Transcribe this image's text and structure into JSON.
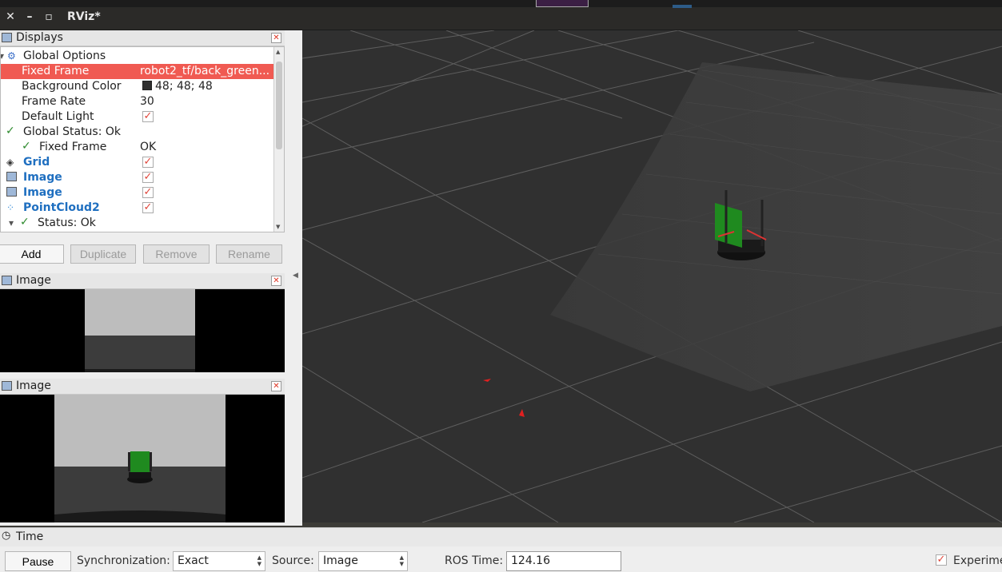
{
  "window": {
    "title": "RViz*"
  },
  "displays_panel": {
    "title": "Displays",
    "rows": {
      "global_options": "Global Options",
      "fixed_frame_label": "Fixed Frame",
      "fixed_frame_value": "robot2_tf/back_green...",
      "bg_color_label": "Background Color",
      "bg_color_value": "48; 48; 48",
      "frame_rate_label": "Frame Rate",
      "frame_rate_value": "30",
      "default_light_label": "Default Light",
      "global_status": "Global Status: Ok",
      "fixed_frame_status_label": "Fixed Frame",
      "fixed_frame_status_value": "OK",
      "grid": "Grid",
      "image1": "Image",
      "image2": "Image",
      "pointcloud": "PointCloud2",
      "status": "Status: Ok"
    },
    "buttons": {
      "add": "Add",
      "duplicate": "Duplicate",
      "remove": "Remove",
      "rename": "Rename"
    }
  },
  "image_panel_1": {
    "title": "Image"
  },
  "image_panel_2": {
    "title": "Image"
  },
  "time_panel": {
    "title": "Time",
    "pause": "Pause",
    "sync_label": "Synchronization:",
    "sync_value": "Exact",
    "source_label": "Source:",
    "source_value": "Image",
    "ros_time_label": "ROS Time:",
    "ros_time_value": "124.16",
    "experimental_label": "Experime"
  },
  "colors": {
    "background": "#303030",
    "selection": "#f05a52",
    "robot_green": "#1f8a1f"
  },
  "icons": [
    "close-icon",
    "minimize-icon",
    "maximize-icon",
    "monitor-icon",
    "gear-icon",
    "grid-icon",
    "image-icon",
    "pointcloud-icon",
    "clock-icon",
    "checkmark-icon"
  ]
}
